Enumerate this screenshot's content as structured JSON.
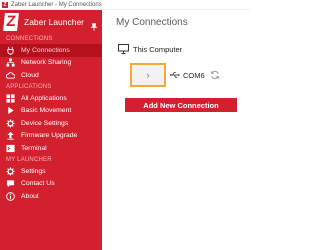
{
  "window": {
    "title": "Zaber Launcher - My Connections"
  },
  "sidebar": {
    "brand_letter": "Z",
    "brand_name": "Zaber Launcher",
    "sections": {
      "connections": "CONNECTIONS",
      "applications": "APPLICATIONS",
      "my_launcher": "MY LAUNCHER"
    },
    "items": [
      {
        "label": "My Connections",
        "icon": "plug-icon",
        "active": true
      },
      {
        "label": "Network Sharing",
        "icon": "network-icon"
      },
      {
        "label": "Cloud",
        "icon": "cloud-icon"
      },
      {
        "label": "All Applications",
        "icon": "grid-icon"
      },
      {
        "label": "Basic Movement",
        "icon": "play-icon"
      },
      {
        "label": "Device Settings",
        "icon": "gear-icon"
      },
      {
        "label": "Firmware Upgrade",
        "icon": "upload-icon"
      },
      {
        "label": "Terminal",
        "icon": "terminal-icon"
      },
      {
        "label": "Settings",
        "icon": "settings-icon"
      },
      {
        "label": "Contact Us",
        "icon": "chat-icon"
      },
      {
        "label": "About",
        "icon": "info-icon"
      }
    ]
  },
  "main": {
    "title": "My Connections",
    "computer_label": "This Computer",
    "expand_symbol": "›",
    "port_label": "COM6",
    "add_button_label": "Add New Connection"
  },
  "colors": {
    "brand_red": "#d3202f",
    "active_red": "#b4101d",
    "highlight_orange": "#f2a93b"
  }
}
